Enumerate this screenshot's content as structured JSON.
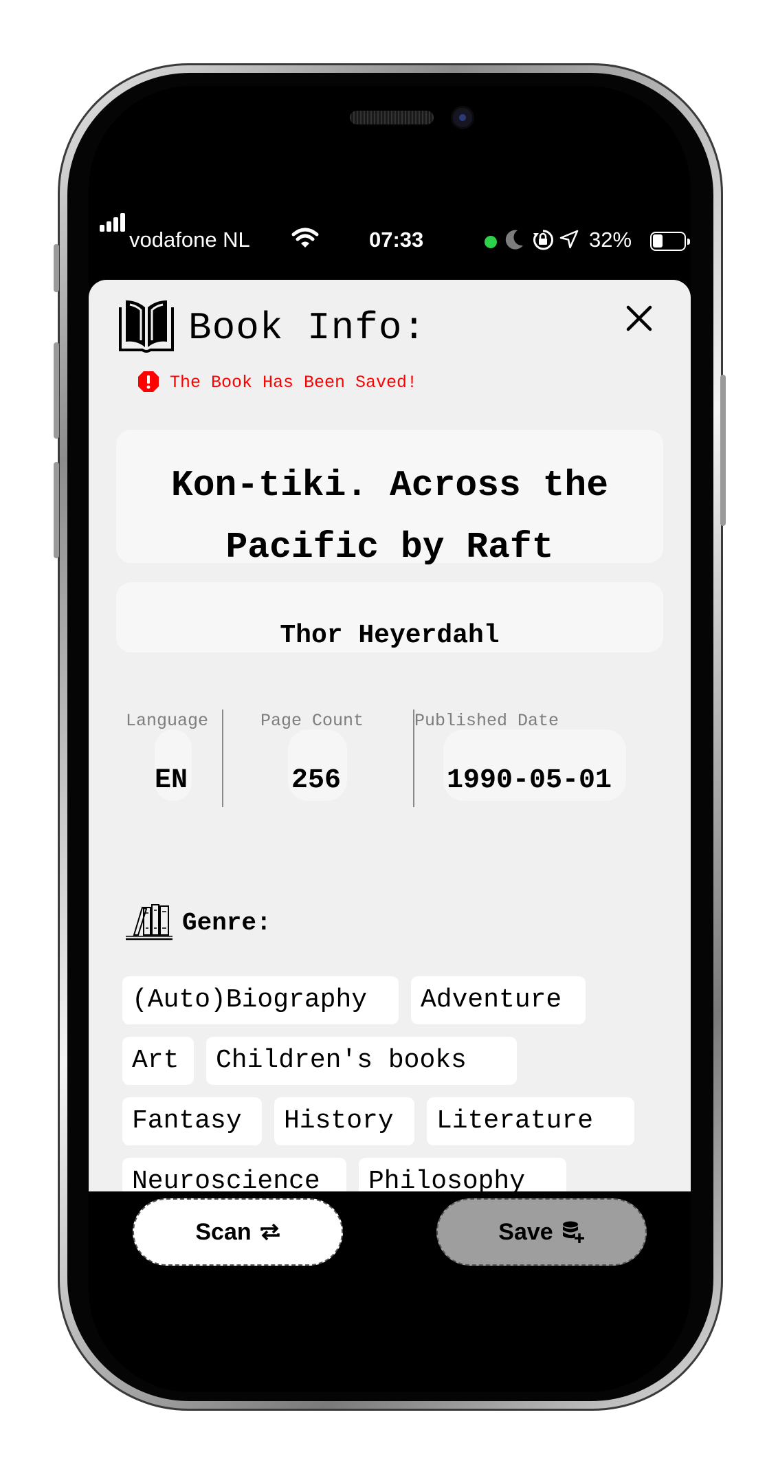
{
  "status_bar": {
    "carrier": "vodafone NL",
    "time": "07:33",
    "battery": "32%",
    "icons": [
      "signal-icon",
      "wifi-icon",
      "camera-in-use-dot",
      "moon-icon",
      "orientation-lock-icon",
      "location-icon",
      "battery-icon"
    ]
  },
  "header": {
    "title": "Book Info:",
    "icons": [
      "book-icon",
      "close-icon"
    ]
  },
  "alert": {
    "message": "The Book Has Been Saved!",
    "color": "#ff0000"
  },
  "book": {
    "title_line1": "Kon-tiki. Across the",
    "title_line2": "Pacific by Raft",
    "author": "Thor Heyerdahl"
  },
  "meta": {
    "language_label": "Language",
    "language_value": "EN",
    "page_count_label": "Page Count",
    "page_count_value": "256",
    "published_label": "Published Date",
    "published_value": "1990-05-01"
  },
  "genre": {
    "label": "Genre:",
    "chips": [
      "(Auto)Biography",
      "Adventure",
      "Art",
      "Children's books",
      "Fantasy",
      "History",
      "Literature",
      "Neuroscience",
      "Philosophy"
    ]
  },
  "actions": {
    "scan_label": "Scan",
    "save_label": "Save"
  }
}
